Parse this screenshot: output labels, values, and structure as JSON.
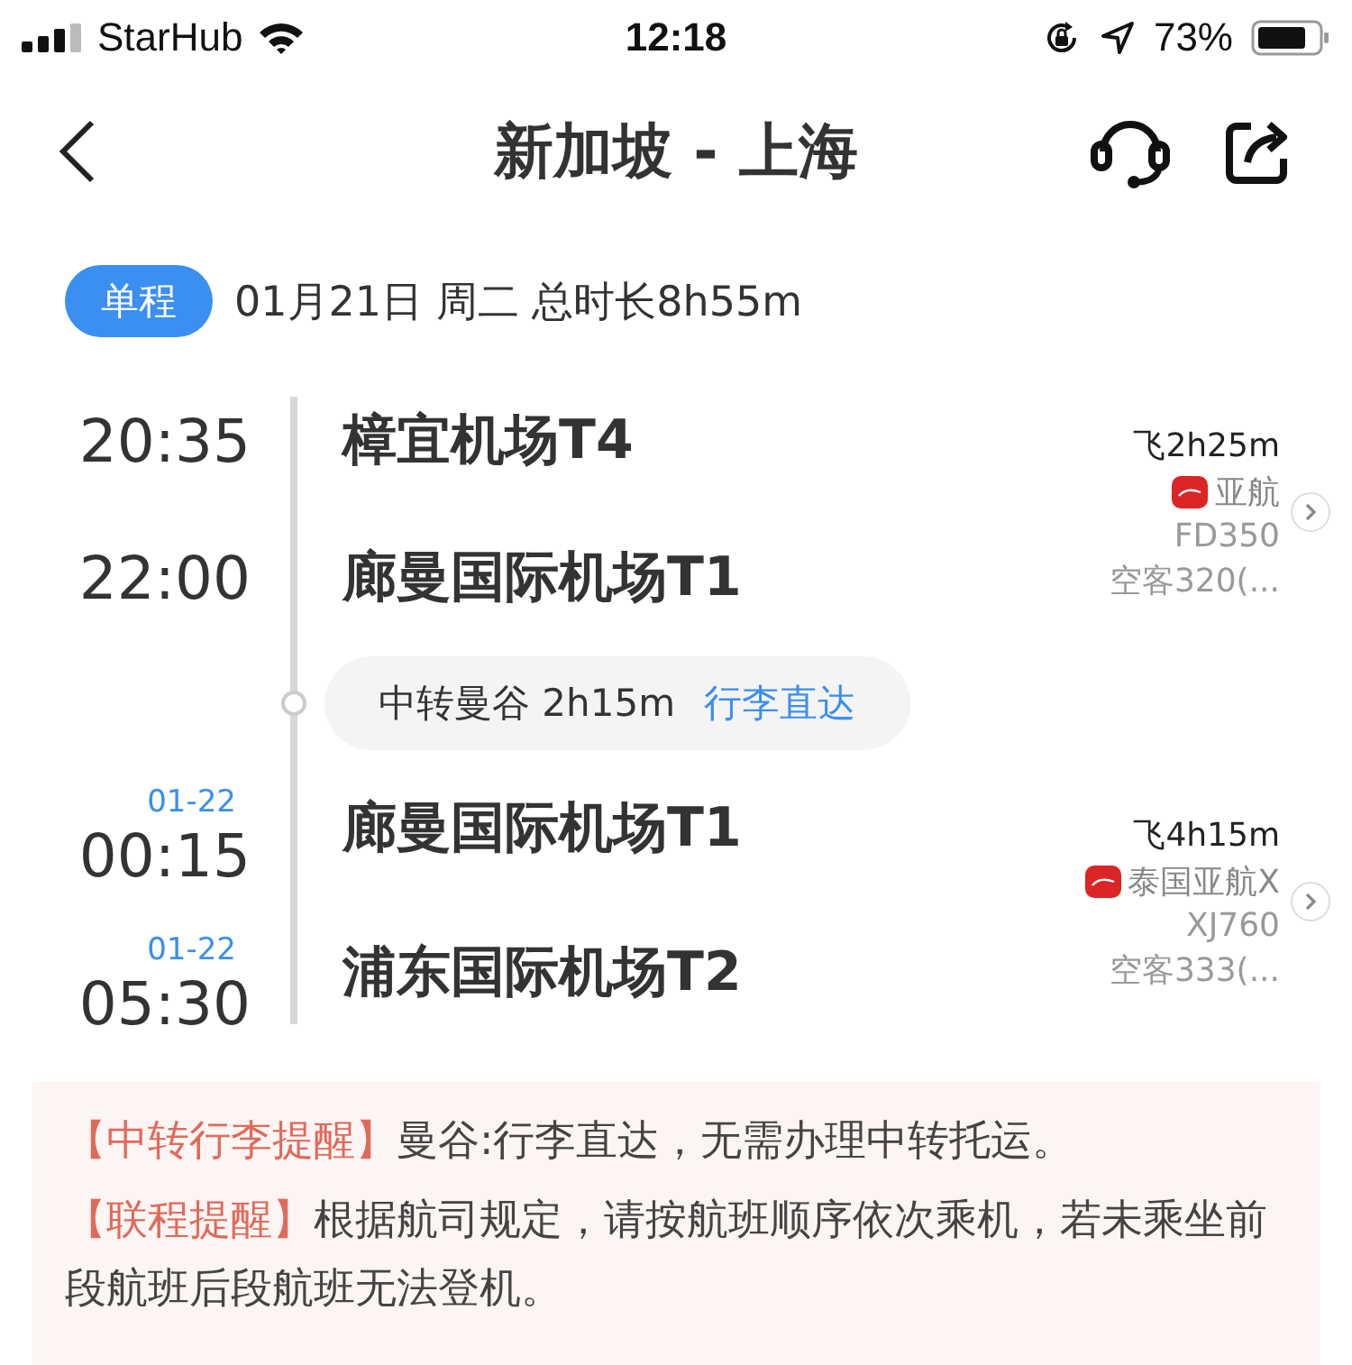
{
  "status_bar": {
    "carrier": "StarHub",
    "time": "12:18",
    "battery": "73%"
  },
  "nav": {
    "title": "新加坡 - 上海"
  },
  "trip": {
    "badge": "单程",
    "summary": "01月21日 周二 总时长8h55m"
  },
  "segments": [
    {
      "duration": "飞2h25m",
      "airline": "亚航",
      "flight": "FD350",
      "aircraft": "空客320(...",
      "stops": [
        {
          "time": "20:35",
          "airport": "樟宜机场T4"
        },
        {
          "time": "22:00",
          "airport": "廊曼国际机场T1"
        }
      ]
    },
    {
      "duration": "飞4h15m",
      "airline": "泰国亚航X",
      "flight": "XJ760",
      "aircraft": "空客333(...",
      "stops": [
        {
          "date": "01-22",
          "time": "00:15",
          "airport": "廊曼国际机场T1"
        },
        {
          "date": "01-22",
          "time": "05:30",
          "airport": "浦东国际机场T2"
        }
      ]
    }
  ],
  "transfer": {
    "text": "中转曼谷 2h15m",
    "link": "行李直达"
  },
  "notices": [
    {
      "label": "【中转行李提醒】",
      "text": "曼谷:行李直达，无需办理中转托运。"
    },
    {
      "label": "【联程提醒】",
      "text": "根据航司规定，请按航班顺序依次乘机，若未乘坐前段航班后段航班无法登机。"
    }
  ]
}
